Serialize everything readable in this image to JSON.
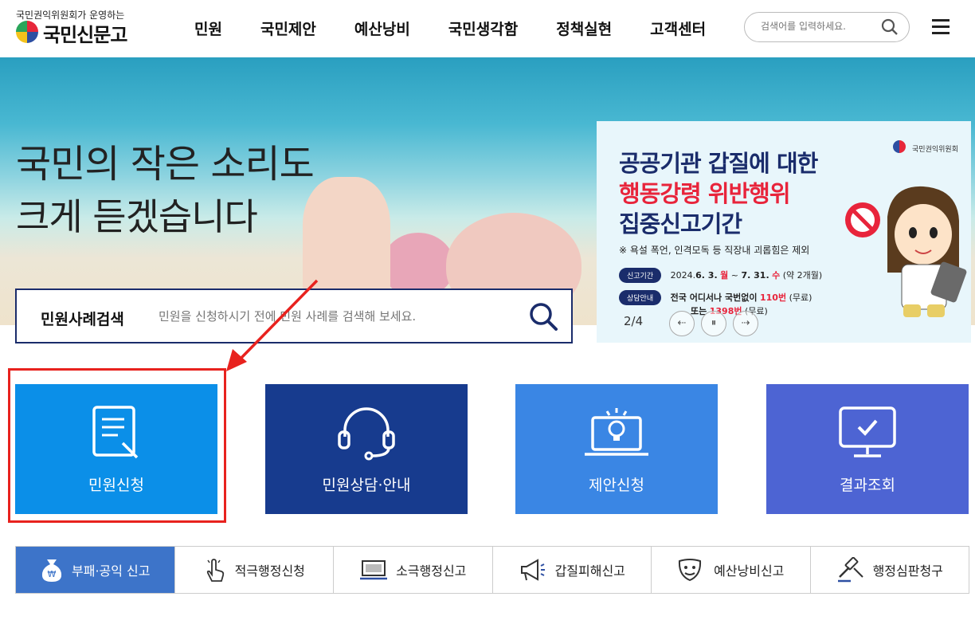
{
  "header": {
    "logo_sub": "국민권익위원회가 운영하는",
    "logo_main": "국민신문고",
    "nav": [
      "민원",
      "국민제안",
      "예산낭비",
      "국민생각함",
      "정책실현",
      "고객센터"
    ],
    "search_placeholder": "검색어를 입력하세요."
  },
  "hero": {
    "line1": "국민의 작은 소리도",
    "line2": "크게 듣겠습니다"
  },
  "case_search": {
    "label": "민원사례검색",
    "placeholder": "민원을 신청하시기 전에 민원 사례를 검색해 보세요."
  },
  "banner": {
    "org": "국민권익위원회",
    "title1": "공공기관 갑질에 대한",
    "title2": "행동강령 위반행위",
    "title3": "집중신고기간",
    "note": "※ 욕설 폭언, 인격모독 등 직장내 괴롭힘은 제외",
    "period_label": "신고기간",
    "period_year": "2024.",
    "period_start": "6. 3.",
    "period_start_day": "월",
    "period_sep": "~",
    "period_end": "7. 31.",
    "period_end_day": "수",
    "period_note": "(약 2개월)",
    "contact_label": "상담안내",
    "contact_line1_pre": "전국 어디서나 국번없이",
    "contact_line1_num": "110번",
    "contact_line1_post": "(무료)",
    "contact_line2_pre": "또는",
    "contact_line2_num": "1398번",
    "contact_line2_post": "(무료)",
    "pager": "2/4",
    "prev": "⇠",
    "pause": "⏸",
    "next": "⇢"
  },
  "tiles": [
    {
      "label": "민원신청",
      "color": "#0b8fe8"
    },
    {
      "label": "민원상담·안내",
      "color": "#173b8e"
    },
    {
      "label": "제안신청",
      "color": "#3a86e4"
    },
    {
      "label": "결과조회",
      "color": "#4d64d3"
    }
  ],
  "quick": [
    "부패·공익 신고",
    "적극행정신청",
    "소극행정신고",
    "갑질피해신고",
    "예산낭비신고",
    "행정심판청구"
  ],
  "colors": {
    "highlight": "#e8221e",
    "quick_active": "#3d74c9"
  }
}
